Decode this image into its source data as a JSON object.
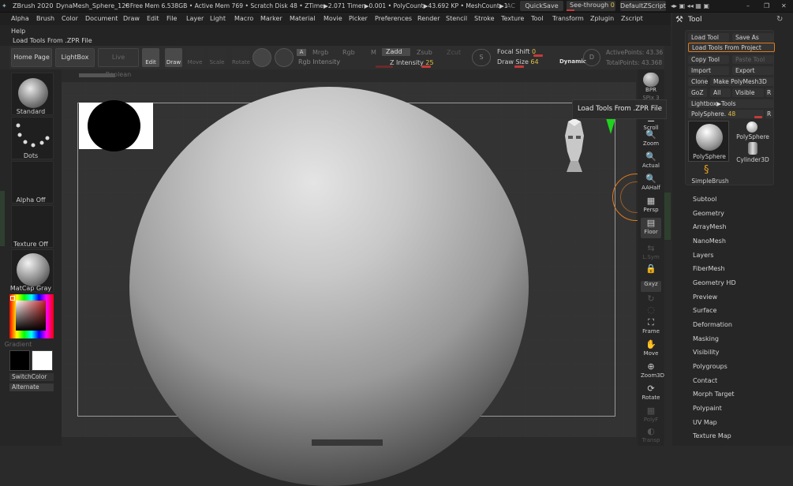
{
  "titlebar": {
    "app": "ZBrush 2020",
    "file": "DynaMesh_Sphere_128",
    "stats": "• Free Mem 6.538GB • Active Mem 769 • Scratch Disk 48 • ZTime▶2.071 Timer▶0.001 • PolyCount▶43.692 KP • MeshCount▶1",
    "ac": "AC",
    "quicksave": "QuickSave",
    "seethrough_label": "See-through",
    "seethrough_value": "0",
    "script": "DefaultZScript"
  },
  "menu": [
    "Alpha",
    "Brush",
    "Color",
    "Document",
    "Draw",
    "Edit",
    "File",
    "Layer",
    "Light",
    "Macro",
    "Marker",
    "Material",
    "Movie",
    "Picker",
    "Preferences",
    "Render",
    "Stencil",
    "Stroke",
    "Texture",
    "Tool",
    "Transform",
    "Zplugin",
    "Zscript"
  ],
  "help": "Help",
  "context_hint": "Load Tools From .ZPR File",
  "toolbar": {
    "home": "Home Page",
    "lightbox": "LightBox",
    "live_boolean": "Live Boolean",
    "edit": "Edit",
    "draw": "Draw",
    "move": "Move",
    "scale": "Scale",
    "rotate": "Rotate",
    "a": "A",
    "mrgb": "Mrgb",
    "rgb": "Rgb",
    "m": "M",
    "zadd": "Zadd",
    "zsub": "Zsub",
    "zcut": "Zcut",
    "rgb_intensity": "Rgb Intensity",
    "z_intensity_label": "Z Intensity",
    "z_intensity": "25",
    "focal_shift_label": "Focal Shift",
    "focal_shift": "0",
    "draw_size_label": "Draw Size",
    "draw_size": "64",
    "dynamic": "Dynamic",
    "active_points": "ActivePoints: 43.36",
    "total_points": "TotalPoints: 43.368"
  },
  "left": {
    "brush": "Standard",
    "stroke": "Dots",
    "alpha": "Alpha Off",
    "texture": "Texture Off",
    "material": "MatCap Gray",
    "gradient": "Gradient",
    "switch_color": "SwitchColor",
    "alternate": "Alternate"
  },
  "right_shelf": [
    "BPR",
    "SPix 3",
    "Scroll",
    "Zoom",
    "Actual",
    "AAHalf",
    "Persp",
    "Floor",
    "L.Sym",
    "",
    "Gxyz",
    "",
    "",
    "Frame",
    "Move",
    "Zoom3D",
    "Rotate",
    "Line Fill",
    "PolyF",
    "Transp"
  ],
  "tool_panel": {
    "title": "Tool",
    "load_tool": "Load Tool",
    "save_as": "Save As",
    "load_from_project": "Load Tools From Project",
    "copy_tool": "Copy Tool",
    "paste_tool": "Paste Tool",
    "import": "Import",
    "export": "Export",
    "clone": "Clone",
    "make_polymesh": "Make PolyMesh3D",
    "goz": "GoZ",
    "all": "All",
    "visible": "Visible",
    "r": "R",
    "lightbox_tools": "Lightbox▶Tools",
    "polysphere_slider_label": "PolySphere.",
    "polysphere_slider_value": "48",
    "thumbs": [
      "PolySphere",
      "PolySphere",
      "Cylinder3D",
      "SimpleBrush"
    ],
    "subpalettes": [
      "Subtool",
      "Geometry",
      "ArrayMesh",
      "NanoMesh",
      "Layers",
      "FiberMesh",
      "Geometry HD",
      "Preview",
      "Surface",
      "Deformation",
      "Masking",
      "Visibility",
      "Polygroups",
      "Contact",
      "Morph Target",
      "Polypaint",
      "UV Map",
      "Texture Map"
    ]
  },
  "tooltip": "Load Tools From .ZPR File",
  "colors": {
    "accent_orange": "#e07a1a",
    "red_slider": "#c53a3a",
    "green_gizmo": "#1fd31f"
  }
}
